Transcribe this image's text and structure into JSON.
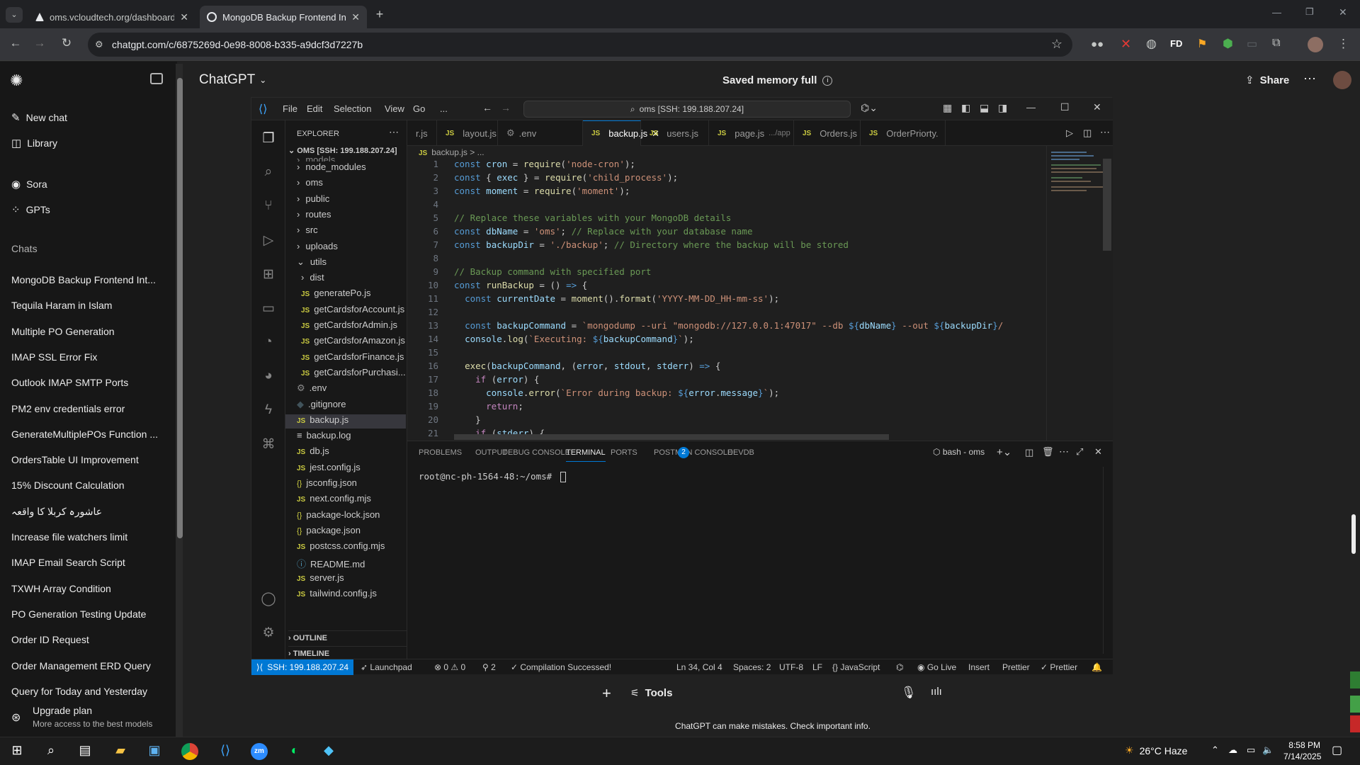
{
  "browser": {
    "tabs": [
      {
        "label": "oms.vcloudtech.org/dashboard",
        "active": false
      },
      {
        "label": "MongoDB Backup Frontend Int",
        "active": true
      }
    ],
    "new_tab_icon": "plus-icon",
    "url": "chatgpt.com/c/6875269d-0e98-8008-b335-a9dcf3d7227b",
    "extension_fd": "FD"
  },
  "chatgpt": {
    "sidebar": {
      "new_chat": "New chat",
      "library": "Library",
      "sora": "Sora",
      "gpts": "GPTs",
      "chats_heading": "Chats",
      "chats": [
        "MongoDB Backup Frontend Int...",
        "Tequila Haram in Islam",
        "Multiple PO Generation",
        "IMAP SSL Error Fix",
        "Outlook IMAP SMTP Ports",
        "PM2 env credentials error",
        "GenerateMultiplePOs Function ...",
        "OrdersTable UI Improvement",
        "15% Discount Calculation",
        "عاشورہ کربلا کا واقعہ",
        "Increase file watchers limit",
        "IMAP Email Search Script",
        "TXWH Array Condition",
        "PO Generation Testing Update",
        "Order ID Request",
        "Order Management ERD Query",
        "Query for Today and Yesterday"
      ],
      "upgrade_title": "Upgrade plan",
      "upgrade_sub": "More access to the best models"
    },
    "header": {
      "title": "ChatGPT",
      "memory": "Saved memory full",
      "share": "Share"
    },
    "composer": {
      "tools": "Tools"
    },
    "disclaimer": "ChatGPT can make mistakes. Check important info."
  },
  "vscode": {
    "menu": [
      "File",
      "Edit",
      "Selection",
      "View",
      "Go",
      "..."
    ],
    "search": "oms [SSH: 199.188.207.24]",
    "explorer": {
      "title": "EXPLORER",
      "root": "OMS [SSH: 199.188.207.24]",
      "items": [
        {
          "name": "models",
          "type": "folder",
          "indent": 1
        },
        {
          "name": "node_modules",
          "type": "folder",
          "indent": 1
        },
        {
          "name": "oms",
          "type": "folder",
          "indent": 1
        },
        {
          "name": "public",
          "type": "folder",
          "indent": 1
        },
        {
          "name": "routes",
          "type": "folder",
          "indent": 1
        },
        {
          "name": "src",
          "type": "folder",
          "indent": 1
        },
        {
          "name": "uploads",
          "type": "folder",
          "indent": 1
        },
        {
          "name": "utils",
          "type": "folder-open",
          "indent": 1
        },
        {
          "name": "dist",
          "type": "folder",
          "indent": 2
        },
        {
          "name": "generatePo.js",
          "type": "js",
          "indent": 2
        },
        {
          "name": "getCardsforAccount.js",
          "type": "js",
          "indent": 2
        },
        {
          "name": "getCardsforAdmin.js",
          "type": "js",
          "indent": 2
        },
        {
          "name": "getCardsforAmazon.js",
          "type": "js",
          "indent": 2
        },
        {
          "name": "getCardsforFinance.js",
          "type": "js",
          "indent": 2
        },
        {
          "name": "getCardsforPurchasi...",
          "type": "js",
          "indent": 2
        },
        {
          "name": ".env",
          "type": "gear",
          "indent": 1
        },
        {
          "name": ".gitignore",
          "type": "git",
          "indent": 1
        },
        {
          "name": "backup.js",
          "type": "js",
          "indent": 1,
          "selected": true
        },
        {
          "name": "backup.log",
          "type": "text",
          "indent": 1
        },
        {
          "name": "db.js",
          "type": "js",
          "indent": 1
        },
        {
          "name": "jest.config.js",
          "type": "js",
          "indent": 1
        },
        {
          "name": "jsconfig.json",
          "type": "json",
          "indent": 1
        },
        {
          "name": "next.config.mjs",
          "type": "js",
          "indent": 1
        },
        {
          "name": "package-lock.json",
          "type": "json",
          "indent": 1
        },
        {
          "name": "package.json",
          "type": "json",
          "indent": 1
        },
        {
          "name": "postcss.config.mjs",
          "type": "js",
          "indent": 1
        },
        {
          "name": "README.md",
          "type": "info",
          "indent": 1
        },
        {
          "name": "server.js",
          "type": "js",
          "indent": 1
        },
        {
          "name": "tailwind.config.js",
          "type": "js",
          "indent": 1
        }
      ],
      "outline": "OUTLINE",
      "timeline": "TIMELINE"
    },
    "tabs": [
      {
        "label": "r.js",
        "icon": "js"
      },
      {
        "label": "layout.js",
        "icon": "js"
      },
      {
        "label": ".env",
        "icon": "gear"
      },
      {
        "label": "backup.js",
        "icon": "js",
        "active": true
      },
      {
        "label": "users.js",
        "icon": "js"
      },
      {
        "label": "page.js",
        "hint": ".../app",
        "icon": "js"
      },
      {
        "label": "Orders.js",
        "icon": "js"
      },
      {
        "label": "OrderPriorty.",
        "icon": "js"
      }
    ],
    "breadcrumb": "backup.js > ...",
    "code_lines": [
      "1",
      "2",
      "3",
      "4",
      "5",
      "6",
      "7",
      "8",
      "9",
      "10",
      "11",
      "12",
      "13",
      "14",
      "15",
      "16",
      "17",
      "18",
      "19",
      "20",
      "21"
    ],
    "panel": {
      "tabs": [
        "PROBLEMS",
        "OUTPUT",
        "DEBUG CONSOLE",
        "TERMINAL",
        "PORTS",
        "POSTMAN CONSOLE",
        "DEVDB"
      ],
      "ports_badge": "2",
      "shell": "bash - oms",
      "prompt": "root@nc-ph-1564-48:~/oms#"
    },
    "status": {
      "remote": "SSH: 199.188.207.24",
      "launchpad": "Launchpad",
      "errors": "0",
      "warnings": "0",
      "ports": "2",
      "compilation": "Compilation Successed!",
      "position": "Ln 34, Col 4",
      "spaces": "Spaces: 2",
      "encoding": "UTF-8",
      "eol": "LF",
      "language": "JavaScript",
      "golive": "Go Live",
      "insert": "Insert",
      "prettier1": "Prettier",
      "prettier2": "Prettier"
    }
  },
  "taskbar": {
    "weather": "26°C  Haze",
    "time": "8:58 PM",
    "date": "7/14/2025",
    "zoom_label": "zm"
  }
}
